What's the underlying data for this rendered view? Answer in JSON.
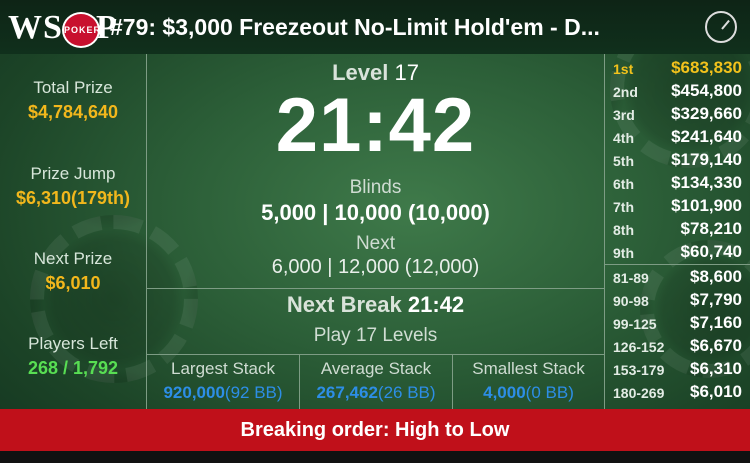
{
  "header": {
    "logo_text": "WSOP",
    "logo_badge": "POKER",
    "title": "#79: $3,000 Freezeout No-Limit Hold'em - D...",
    "clock_icon": "clock-icon"
  },
  "left": {
    "total_prize": {
      "label": "Total Prize",
      "value": "$4,784,640"
    },
    "prize_jump": {
      "label": "Prize Jump",
      "value": "$6,310(179th)"
    },
    "next_prize": {
      "label": "Next Prize",
      "value": "$6,010"
    },
    "players_left": {
      "label": "Players Left",
      "value": "268 / 1,792"
    }
  },
  "center": {
    "level_label": "Level",
    "level_num": "17",
    "timer": "21:42",
    "blinds_label": "Blinds",
    "blinds_value": "5,000 | 10,000 (10,000)",
    "next_label": "Next",
    "next_value": "6,000 | 12,000 (12,000)",
    "break_label": "Next Break",
    "break_time": "21:42",
    "play_levels": "Play 17 Levels",
    "stacks": [
      {
        "label": "Largest Stack",
        "value": "920,000",
        "bb": "(92 BB)"
      },
      {
        "label": "Average Stack",
        "value": "267,462",
        "bb": "(26 BB)"
      },
      {
        "label": "Smallest Stack",
        "value": "4,000",
        "bb": "(0 BB)"
      }
    ]
  },
  "payouts": {
    "top": [
      {
        "place": "1st",
        "amount": "$683,830"
      },
      {
        "place": "2nd",
        "amount": "$454,800"
      },
      {
        "place": "3rd",
        "amount": "$329,660"
      },
      {
        "place": "4th",
        "amount": "$241,640"
      },
      {
        "place": "5th",
        "amount": "$179,140"
      },
      {
        "place": "6th",
        "amount": "$134,330"
      },
      {
        "place": "7th",
        "amount": "$101,900"
      },
      {
        "place": "8th",
        "amount": "$78,210"
      },
      {
        "place": "9th",
        "amount": "$60,740"
      }
    ],
    "ranges": [
      {
        "place": "81-89",
        "amount": "$8,600"
      },
      {
        "place": "90-98",
        "amount": "$7,790"
      },
      {
        "place": "99-125",
        "amount": "$7,160"
      },
      {
        "place": "126-152",
        "amount": "$6,670"
      },
      {
        "place": "153-179",
        "amount": "$6,310"
      },
      {
        "place": "180-269",
        "amount": "$6,010"
      }
    ]
  },
  "banner": {
    "text": "Breaking order:  High to Low"
  },
  "colors": {
    "gold": "#f2b71c",
    "green": "#58de53",
    "blue": "#2d8ee6",
    "banner_red": "#c0101a"
  }
}
